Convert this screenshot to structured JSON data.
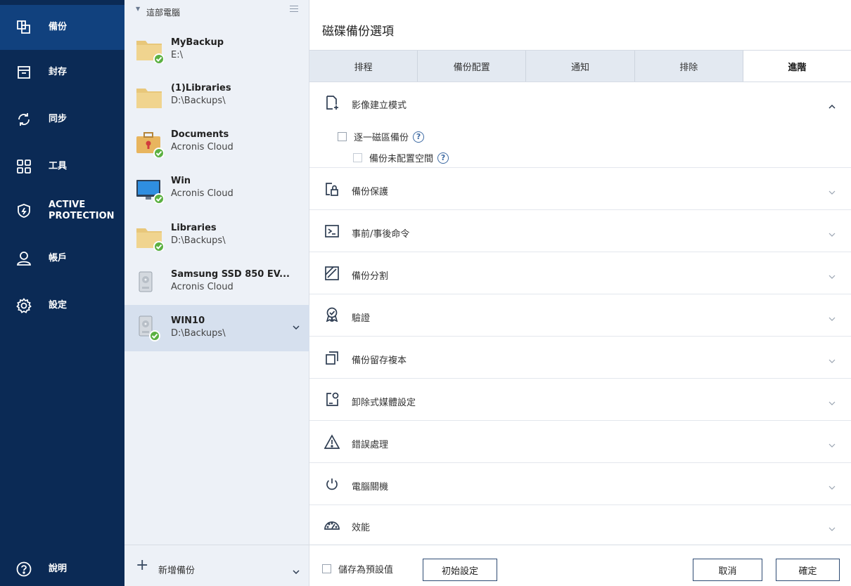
{
  "nav": {
    "items": [
      {
        "label": "備份",
        "icon": "backup-copy-icon",
        "active": true
      },
      {
        "label": "封存",
        "icon": "archive-icon"
      },
      {
        "label": "同步",
        "icon": "sync-icon"
      },
      {
        "label": "工具",
        "icon": "tools-grid-icon"
      },
      {
        "label": "ACTIVE\nPROTECTION",
        "icon": "shield-bolt-icon"
      },
      {
        "label": "帳戶",
        "icon": "account-person-icon"
      },
      {
        "label": "設定",
        "icon": "settings-gear-icon"
      }
    ],
    "help_label": "說明"
  },
  "list": {
    "header": "這部電腦",
    "items": [
      {
        "name": "MyBackup",
        "sub": "E:\\",
        "type": "folder",
        "status": "ok"
      },
      {
        "name": "(1)Libraries",
        "sub": "D:\\Backups\\",
        "type": "folder",
        "status": "none"
      },
      {
        "name": "Documents",
        "sub": "Acronis Cloud",
        "type": "briefcase",
        "status": "ok"
      },
      {
        "name": "Win",
        "sub": "Acronis Cloud",
        "type": "monitor",
        "status": "ok"
      },
      {
        "name": "Libraries",
        "sub": "D:\\Backups\\",
        "type": "folder",
        "status": "ok"
      },
      {
        "name": "Samsung SSD 850 EV...",
        "sub": "Acronis Cloud",
        "type": "disk",
        "status": "none"
      },
      {
        "name": "WIN10",
        "sub": "D:\\Backups\\",
        "type": "disk",
        "status": "ok",
        "selected": true
      }
    ],
    "add_label": "新增備份"
  },
  "panel": {
    "title": "磁碟備份選項",
    "tabs": [
      "排程",
      "備份配置",
      "通知",
      "排除",
      "進階"
    ],
    "active_tab": "進階",
    "sections": [
      {
        "label": "影像建立模式",
        "icon": "image-mode-icon",
        "expanded": true
      },
      {
        "label": "備份保護",
        "icon": "lock-doc-icon"
      },
      {
        "label": "事前/事後命令",
        "icon": "terminal-icon"
      },
      {
        "label": "備份分割",
        "icon": "split-icon"
      },
      {
        "label": "驗證",
        "icon": "badge-icon"
      },
      {
        "label": "備份留存複本",
        "icon": "copy-icon"
      },
      {
        "label": "卸除式媒體設定",
        "icon": "removable-media-icon"
      },
      {
        "label": "錯誤處理",
        "icon": "warning-icon"
      },
      {
        "label": "電腦關機",
        "icon": "power-icon"
      },
      {
        "label": "效能",
        "icon": "gauge-icon"
      }
    ],
    "options": {
      "sector_by_sector": "逐一磁區備份",
      "unallocated": "備份未配置空間",
      "help_glyph": "?"
    },
    "footer": {
      "save_default": "儲存為預設值",
      "reset": "初始設定",
      "cancel": "取消",
      "ok": "確定"
    }
  },
  "colors": {
    "nav_bg": "#0b2a55",
    "nav_active": "#11417e",
    "list_bg": "#edf1f7",
    "status_ok": "#5bb041",
    "folder": "#e8c77a"
  }
}
